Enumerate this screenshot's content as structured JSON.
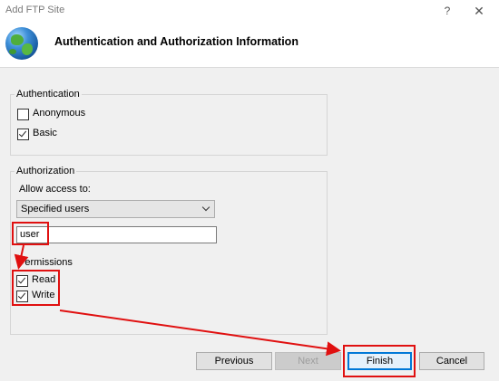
{
  "window": {
    "title": "Add FTP Site",
    "help_glyph": "?",
    "close_glyph": "✕"
  },
  "header": {
    "icon": "globe-icon",
    "title": "Authentication and Authorization Information"
  },
  "authentication": {
    "legend": "Authentication",
    "options": [
      {
        "label": "Anonymous",
        "checked": false
      },
      {
        "label": "Basic",
        "checked": true
      }
    ]
  },
  "authorization": {
    "legend": "Authorization",
    "allow_access_label": "Allow access to:",
    "allow_access_value": "Specified users",
    "users_value": "user",
    "permissions_label": "Permissions",
    "permissions": [
      {
        "label": "Read",
        "checked": true
      },
      {
        "label": "Write",
        "checked": true
      }
    ]
  },
  "buttons": {
    "previous": "Previous",
    "next": "Next",
    "finish": "Finish",
    "cancel": "Cancel"
  },
  "colors": {
    "annotation": "#e01010",
    "focus": "#0078d7"
  }
}
